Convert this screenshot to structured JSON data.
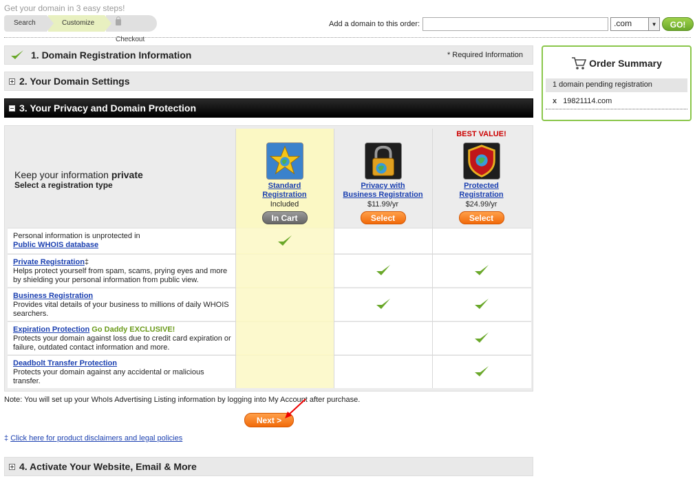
{
  "header": {
    "tagline": "Get your domain in 3 easy steps!",
    "steps": [
      "Search",
      "Customize",
      "Checkout"
    ],
    "add_domain_label": "Add a domain to this order:",
    "domain_input_value": "",
    "tld_selected": ".com",
    "go_label": "GO!"
  },
  "sections": {
    "s1": "1. Domain Registration Information",
    "s1_required": "* Required Information",
    "s2": "2. Your Domain Settings",
    "s3": "3. Your Privacy and Domain Protection",
    "s4": "4. Activate Your Website, Email & More"
  },
  "order_summary": {
    "title": "Order Summary",
    "pending": "1 domain pending registration",
    "remove_symbol": "x",
    "domain": "19821114.com"
  },
  "privacy": {
    "keep_prefix": "Keep your information ",
    "keep_bold": "private",
    "select_type": "Select a registration type",
    "plans": [
      {
        "best": "",
        "name_line1": "Standard",
        "name_line2": "Registration",
        "price": "Included",
        "button": "In Cart",
        "icon": "star-globe-icon"
      },
      {
        "best": "",
        "name_line1": "Privacy with",
        "name_line2": "Business Registration",
        "price": "$11.99/yr",
        "button": "Select",
        "icon": "padlock-globe-icon"
      },
      {
        "best": "BEST VALUE!",
        "name_line1": "Protected",
        "name_line2": "Registration",
        "price": "$24.99/yr",
        "button": "Select",
        "icon": "shield-globe-icon"
      }
    ],
    "features": [
      {
        "pre": "Personal information is unprotected in",
        "link": "Public WHOIS database",
        "suffix": "",
        "excl": "",
        "desc": "",
        "checks": [
          true,
          false,
          false
        ]
      },
      {
        "pre": "",
        "link": "Private Registration",
        "suffix": "‡",
        "excl": "",
        "desc": "Helps protect yourself from spam, scams, prying eyes and more by shielding your personal information from public view.",
        "checks": [
          false,
          true,
          true
        ]
      },
      {
        "pre": "",
        "link": "Business Registration",
        "suffix": "",
        "excl": "",
        "desc": "Provides vital details of your business to millions of daily WHOIS searchers.",
        "checks": [
          false,
          true,
          true
        ]
      },
      {
        "pre": "",
        "link": "Expiration Protection",
        "suffix": "",
        "excl": " Go Daddy EXCLUSIVE!",
        "desc": "Protects your domain against loss due to credit card expiration or failure, outdated contact information and more.",
        "checks": [
          false,
          false,
          true
        ]
      },
      {
        "pre": "",
        "link": "Deadbolt Transfer Protection",
        "suffix": "",
        "excl": "",
        "desc": "Protects your domain against any accidental or malicious transfer.",
        "checks": [
          false,
          false,
          true
        ]
      }
    ]
  },
  "footer": {
    "note": "Note: You will set up your WhoIs Advertising Listing information by logging into My Account after purchase.",
    "next": "Next >",
    "disclaimer_mark": "‡ ",
    "disclaimer_link": "Click here for product disclaimers and legal policies"
  },
  "colors": {
    "accent_green": "#8ac64a",
    "link_blue": "#1a3fb0",
    "orange": "#f16a0a",
    "best_value_red": "#cc0000"
  }
}
